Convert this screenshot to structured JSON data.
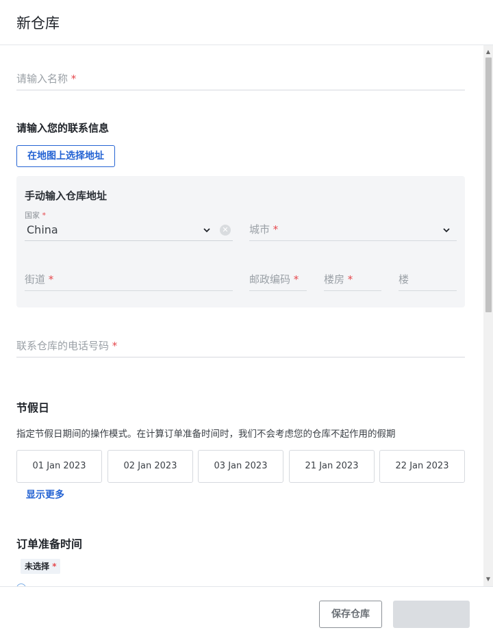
{
  "header": {
    "title": "新仓库"
  },
  "form": {
    "name_placeholder": "请输入名称",
    "contact_title": "请输入您的联系信息",
    "map_button": "在地图上选择地址",
    "manual_title": "手动输入仓库地址",
    "country_label": "国家",
    "country_value": "China",
    "city_placeholder": "城市",
    "street_placeholder": "街道",
    "postal_placeholder": "邮政编码",
    "building_placeholder": "楼房",
    "floor_placeholder": "楼",
    "phone_placeholder": "联系仓库的电话号码",
    "required_mark": "*"
  },
  "holidays": {
    "title": "节假日",
    "description": "指定节假日期间的操作模式。在计算订单准备时间时，我们不会考虑您的仓库不起作用的假期",
    "dates": [
      "01 Jan 2023",
      "02 Jan 2023",
      "03 Jan 2023",
      "21 Jan 2023",
      "22 Jan 2023"
    ],
    "show_more": "显示更多"
  },
  "prep": {
    "title": "订单准备时间",
    "tag": "未选择"
  },
  "footer": {
    "save_button": "保存仓库"
  },
  "icons": {
    "chevron": "chevron-down-icon",
    "clear": "clear-icon",
    "radio": "radio-icon"
  },
  "colors": {
    "accent": "#2463d3",
    "required": "#e5484d"
  }
}
